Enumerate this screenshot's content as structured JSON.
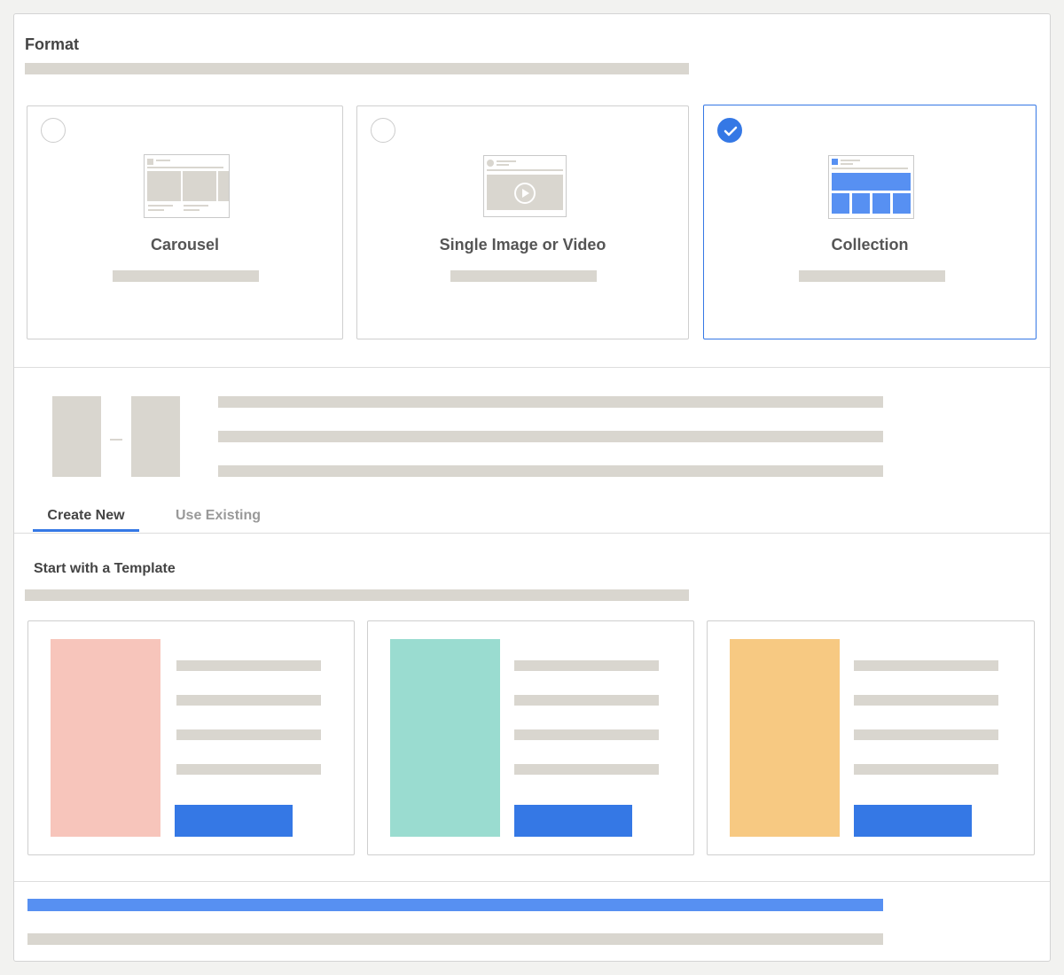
{
  "format": {
    "title": "Format",
    "options": [
      {
        "label": "Carousel",
        "selected": false
      },
      {
        "label": "Single Image or Video",
        "selected": false
      },
      {
        "label": "Collection",
        "selected": true
      }
    ]
  },
  "tabs": [
    {
      "label": "Create New",
      "active": true
    },
    {
      "label": "Use Existing",
      "active": false
    }
  ],
  "templates": {
    "title": "Start with a Template",
    "cards": [
      {
        "color": "#f7c5bb"
      },
      {
        "color": "#9adcd0"
      },
      {
        "color": "#f7c982"
      }
    ]
  },
  "colors": {
    "accent": "#3578e5",
    "placeholder": "#d9d6cf",
    "progress": "#5790f2",
    "tab_inactive": "#999999"
  }
}
